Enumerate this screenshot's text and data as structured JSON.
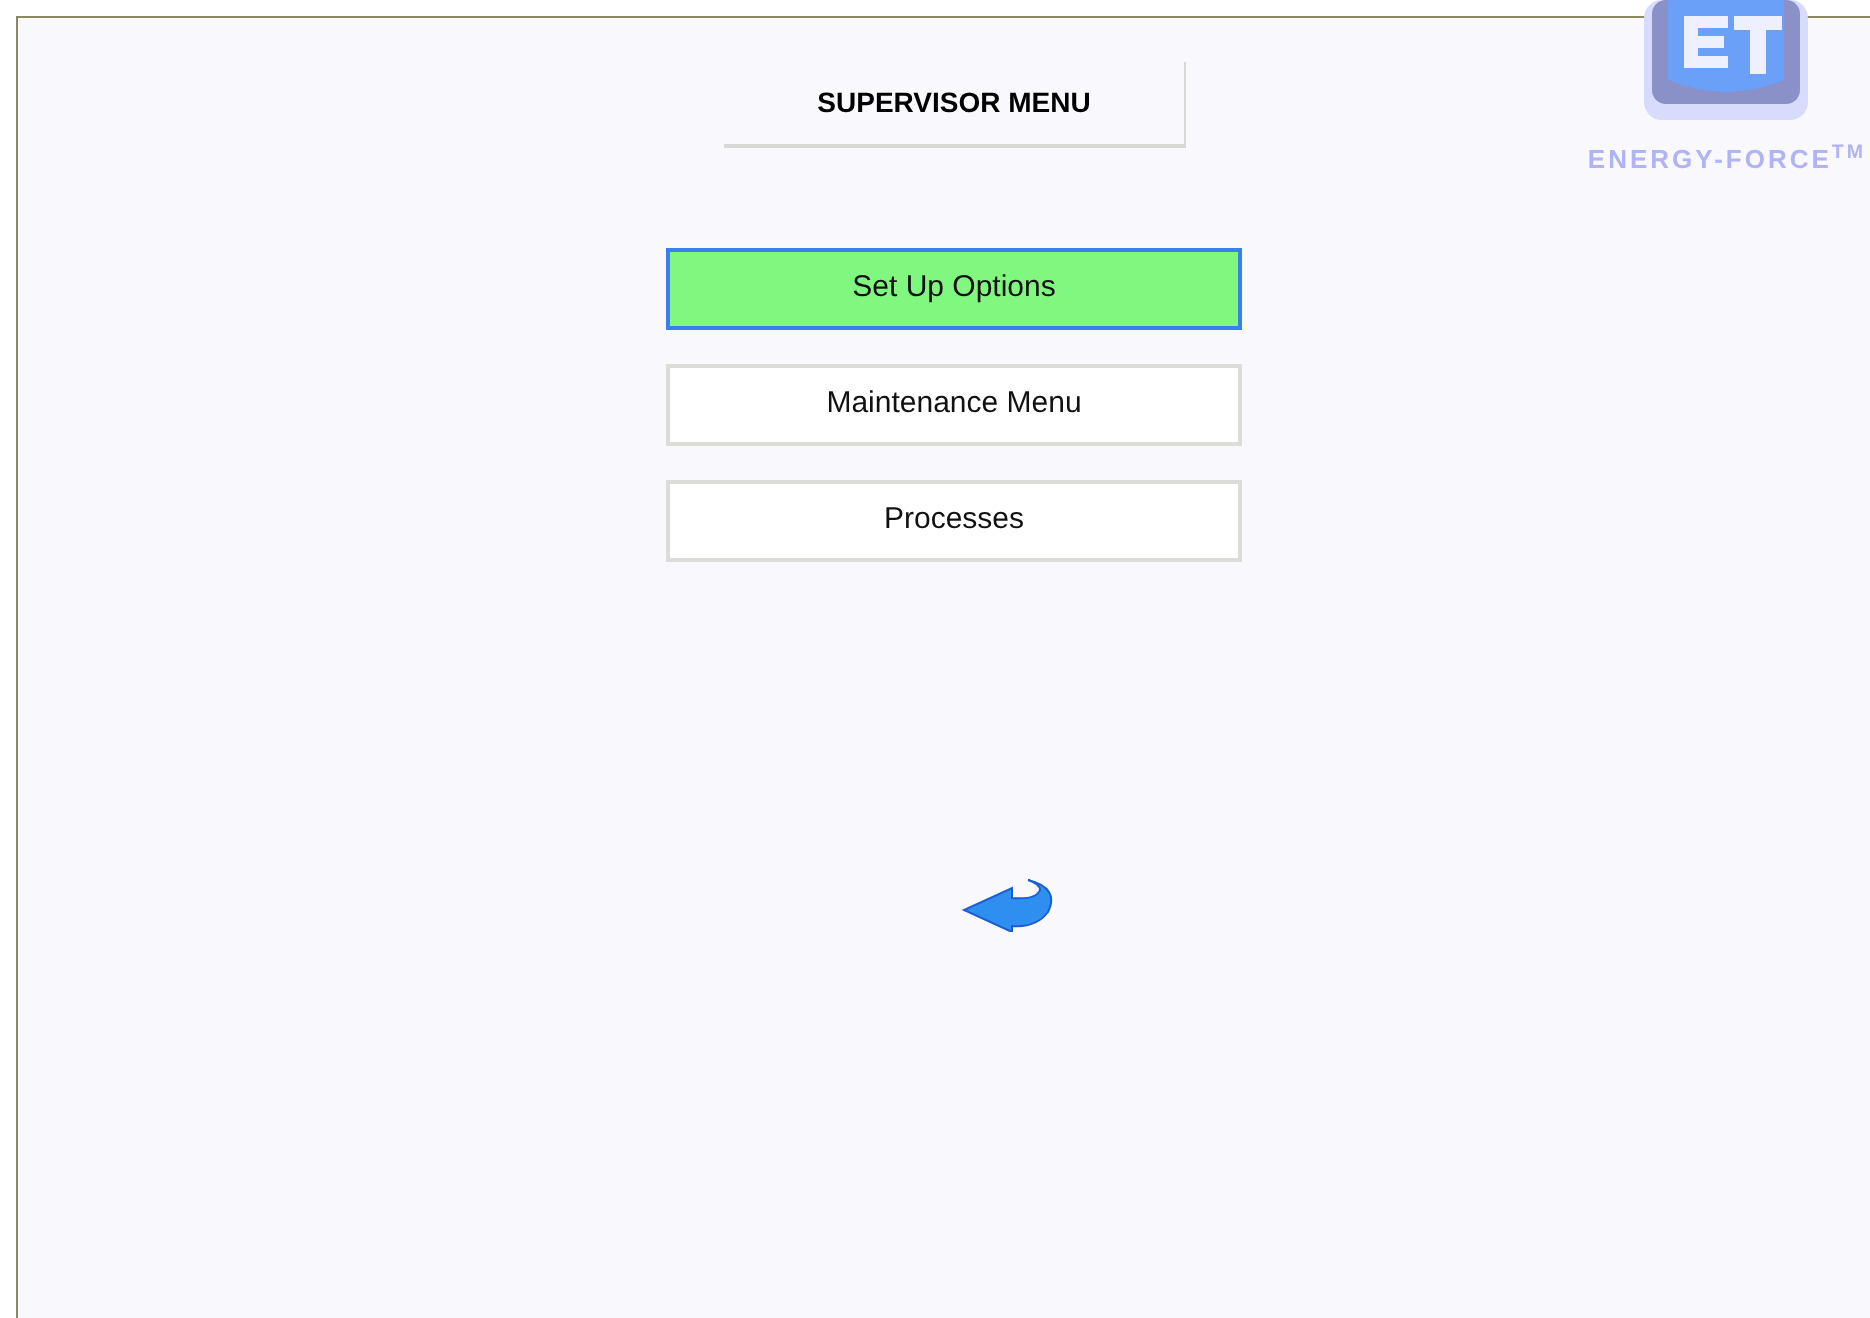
{
  "title": "SUPERVISOR MENU",
  "logo": {
    "text": "ENERGY-FORCE$^{TM}$"
  },
  "menu": [
    {
      "label": "Set Up Options",
      "selected": true
    },
    {
      "label": "Maintenance Menu",
      "selected": false
    },
    {
      "label": "Processes",
      "selected": false
    }
  ],
  "back": {
    "kind": "arrow"
  }
}
